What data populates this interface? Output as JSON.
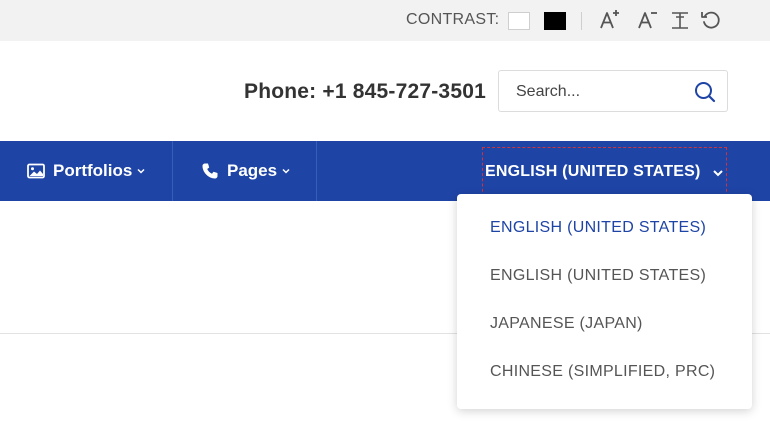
{
  "topbar": {
    "contrast_label": "CONTRAST:",
    "contrast_options": [
      "white",
      "black"
    ],
    "icons": [
      "font-increase-icon",
      "font-decrease-icon",
      "text-height-icon",
      "reset-icon"
    ]
  },
  "header": {
    "phone": "Phone: +1 845-727-3501",
    "search": {
      "placeholder": "Search...",
      "value": ""
    }
  },
  "nav": {
    "items": [
      {
        "label": "Portfolios",
        "icon": "image-icon"
      },
      {
        "label": "Pages",
        "icon": "phone-icon"
      }
    ],
    "language_selected": "ENGLISH (UNITED STATES)"
  },
  "language_menu": {
    "options": [
      {
        "label": "ENGLISH (UNITED STATES)",
        "active": true
      },
      {
        "label": "ENGLISH (UNITED STATES)",
        "active": false
      },
      {
        "label": "JAPANESE (JAPAN)",
        "active": false
      },
      {
        "label": "CHINESE (SIMPLIFIED, PRC)",
        "active": false
      }
    ]
  },
  "colors": {
    "nav_background": "#1e44a6",
    "active_option": "#1e44a6",
    "topbar_background": "#f2f2f2"
  }
}
